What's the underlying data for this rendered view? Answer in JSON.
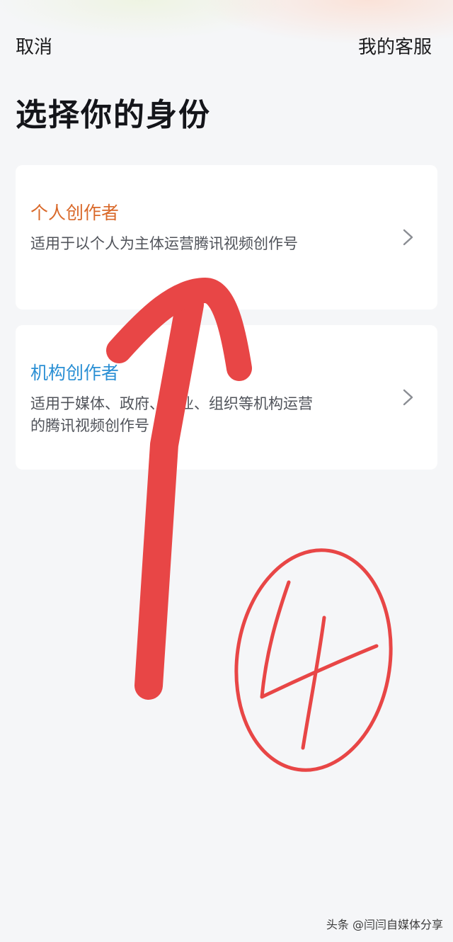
{
  "header": {
    "cancel_label": "取消",
    "service_label": "我的客服"
  },
  "page": {
    "title": "选择你的身份"
  },
  "options": [
    {
      "title": "个人创作者",
      "description": "适用于以个人为主体运营腾讯视频创作号"
    },
    {
      "title": "机构创作者",
      "description": "适用于媒体、政府、企业、组织等机构运营的腾讯视频创作号"
    }
  ],
  "annotation": {
    "step_number": "4",
    "ink_color": "#e84646",
    "icons": [
      "up-arrow-annotation",
      "circled-number-annotation"
    ]
  },
  "watermark": {
    "text": "头条 @闫闫自媒体分享"
  },
  "colors": {
    "personal_accent": "#d9692a",
    "org_accent": "#2a8fd4",
    "background": "#f5f6f8"
  }
}
